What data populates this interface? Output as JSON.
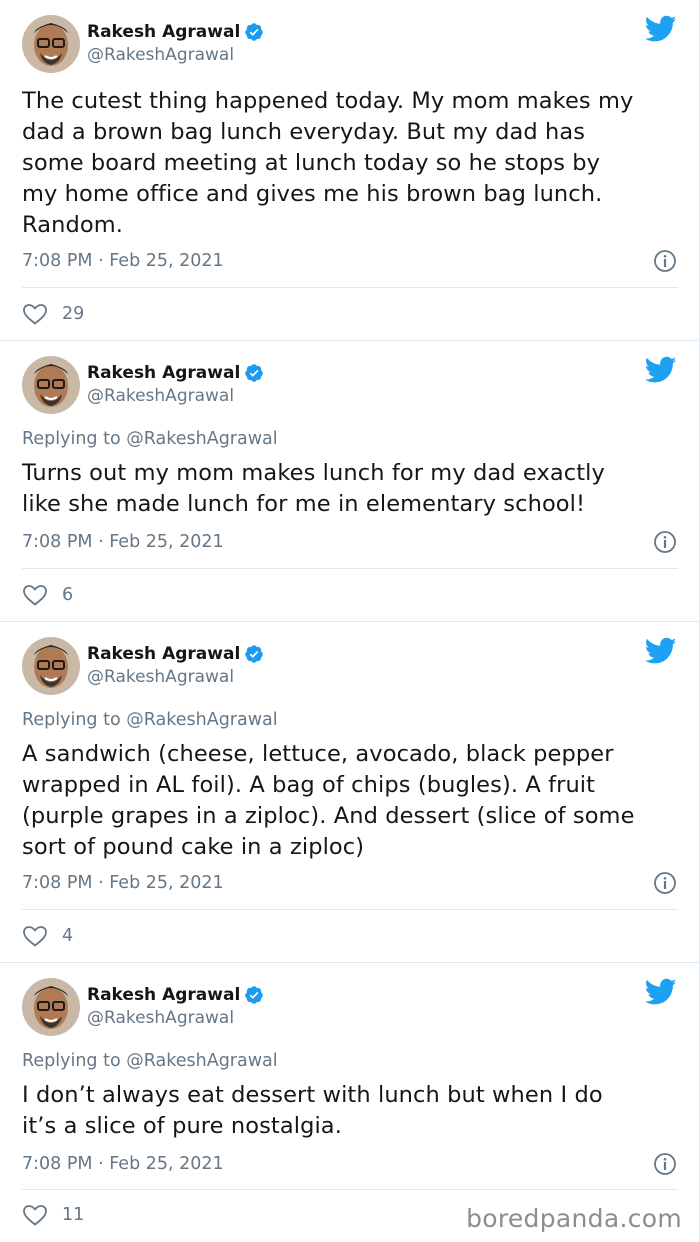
{
  "watermark": "boredpanda.com",
  "colors": {
    "verified": "#1d9bf0",
    "twitter_bird": "#1da1f2",
    "muted": "#657786",
    "divider": "#e1e8ed"
  },
  "icons": {
    "verified": "verified-badge-icon",
    "brand": "twitter-bird-icon",
    "info": "info-icon",
    "like": "heart-icon"
  },
  "tweets": [
    {
      "name": "Rakesh Agrawal",
      "handle": "@RakeshAgrawal",
      "replying_label": "",
      "replying_to": "",
      "text": "The cutest thing happened today. My mom makes my\ndad a brown bag lunch everyday. But my dad has\nsome board meeting at lunch today so he stops by\nmy home office and gives me his brown bag lunch.\nRandom.",
      "timestamp": "7:08 PM · Feb 25, 2021",
      "likes": "29"
    },
    {
      "name": "Rakesh Agrawal",
      "handle": "@RakeshAgrawal",
      "replying_label": "Replying to ",
      "replying_to": "@RakeshAgrawal",
      "text": "Turns out my mom makes lunch for my dad exactly\nlike she made lunch for me in elementary school!",
      "timestamp": "7:08 PM · Feb 25, 2021",
      "likes": "6"
    },
    {
      "name": "Rakesh Agrawal",
      "handle": "@RakeshAgrawal",
      "replying_label": "Replying to ",
      "replying_to": "@RakeshAgrawal",
      "text": "A sandwich (cheese, lettuce, avocado, black pepper\nwrapped in AL foil). A bag of chips (bugles). A fruit\n(purple grapes in a ziploc). And dessert (slice of some\nsort of pound cake in a ziploc)",
      "timestamp": "7:08 PM · Feb 25, 2021",
      "likes": "4"
    },
    {
      "name": "Rakesh Agrawal",
      "handle": "@RakeshAgrawal",
      "replying_label": "Replying to ",
      "replying_to": "@RakeshAgrawal",
      "text": "I don’t always eat dessert with lunch but when I do\nit’s a slice of pure nostalgia.",
      "timestamp": "7:08 PM · Feb 25, 2021",
      "likes": "11"
    }
  ]
}
